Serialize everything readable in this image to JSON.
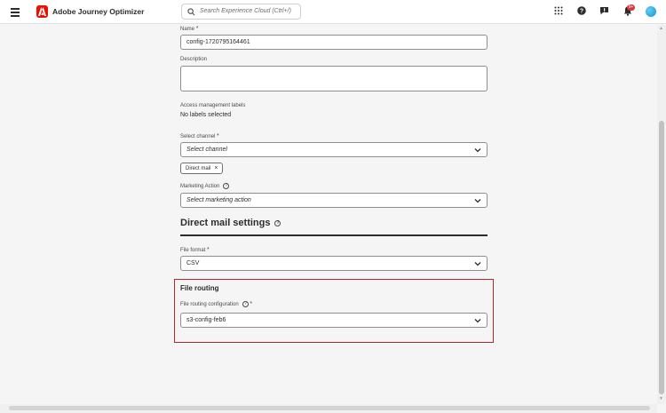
{
  "header": {
    "app_title": "Adobe Journey Optimizer",
    "search_placeholder": "Search Experience Cloud (Ctrl+/)",
    "notification_badge": "9+",
    "brand_color": "#eb1000"
  },
  "form": {
    "name": {
      "label": "Name",
      "value": "config-1720795164461"
    },
    "description": {
      "label": "Description",
      "value": ""
    },
    "access_labels": {
      "label": "Access management labels",
      "value": "No labels selected"
    },
    "channel": {
      "label": "Select channel",
      "placeholder": "Select channel",
      "selected_tag": "Direct mail"
    },
    "marketing_action": {
      "label": "Marketing Action",
      "placeholder": "Select marketing action"
    },
    "direct_mail_settings": {
      "title": "Direct mail settings",
      "file_format": {
        "label": "File format",
        "value": "CSV"
      }
    },
    "file_routing": {
      "title": "File routing",
      "config_label": "File routing configuration",
      "config_value": "s3-config-feb6",
      "highlight_color": "#b3272f"
    }
  }
}
